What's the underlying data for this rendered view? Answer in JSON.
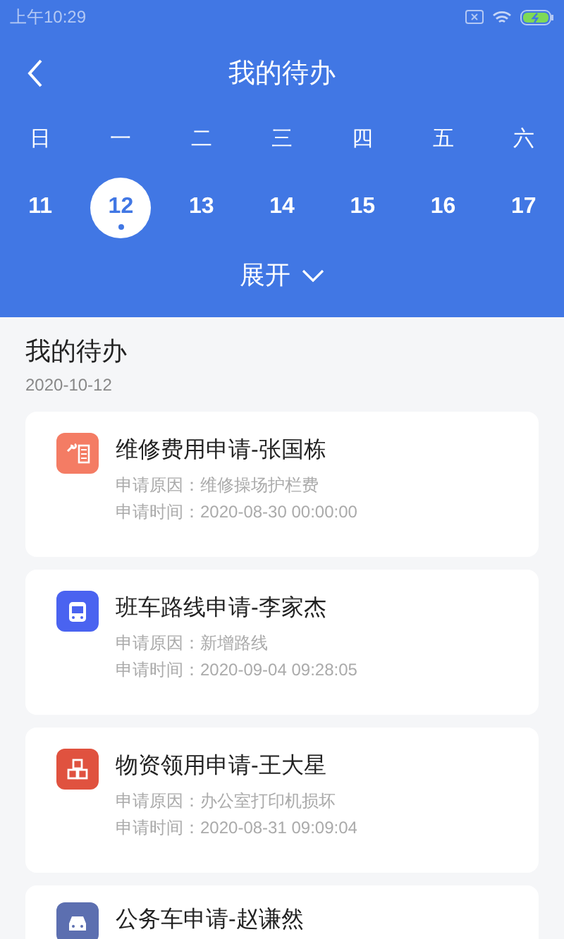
{
  "status_bar": {
    "time": "上午10:29"
  },
  "header": {
    "title": "我的待办"
  },
  "calendar": {
    "weekdays": [
      "日",
      "一",
      "二",
      "三",
      "四",
      "五",
      "六"
    ],
    "days": [
      {
        "label": "11",
        "selected": false,
        "has_dot": false
      },
      {
        "label": "12",
        "selected": true,
        "has_dot": true
      },
      {
        "label": "13",
        "selected": false,
        "has_dot": false
      },
      {
        "label": "14",
        "selected": false,
        "has_dot": false
      },
      {
        "label": "15",
        "selected": false,
        "has_dot": false
      },
      {
        "label": "16",
        "selected": false,
        "has_dot": false
      },
      {
        "label": "17",
        "selected": false,
        "has_dot": false
      }
    ],
    "expand": {
      "label": "展开"
    }
  },
  "section": {
    "title": "我的待办",
    "date": "2020-10-12"
  },
  "tasks": [
    {
      "kind": "repair",
      "color": "#f47c64",
      "title": "维修费用申请-张国栋",
      "lines": [
        "申请原因：维修操场护栏费",
        "申请时间：2020-08-30 00:00:00"
      ]
    },
    {
      "kind": "bus",
      "color": "#4a63f0",
      "title": "班车路线申请-李家杰",
      "lines": [
        "申请原因：新增路线",
        "申请时间：2020-09-04 09:28:05"
      ]
    },
    {
      "kind": "boxes",
      "color": "#e0523f",
      "title": "物资领用申请-王大星",
      "lines": [
        "申请原因：办公室打印机损坏",
        "申请时间：2020-08-31 09:09:04"
      ]
    },
    {
      "kind": "car",
      "color": "#5c6fb0",
      "title": "公务车申请-赵谦然"
    }
  ]
}
